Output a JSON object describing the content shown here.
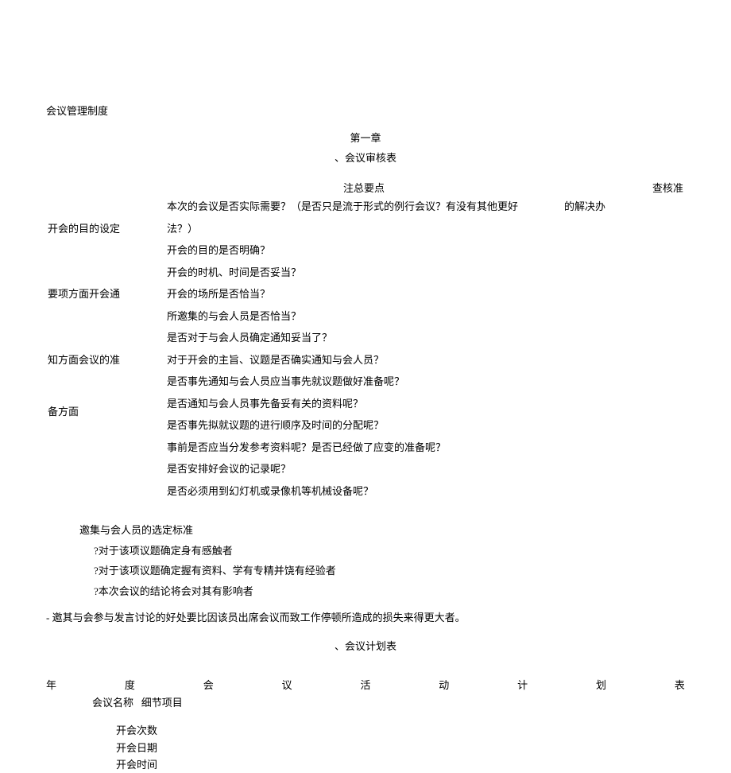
{
  "doc_title": "会议管理制度",
  "chapter_title": "第一章",
  "section1_title": "、会议审核表",
  "header": {
    "mid": "注总要点",
    "right": "查核准"
  },
  "groups": [
    {
      "left": "开会的目的设定",
      "lines": [
        {
          "text": "本次的会议是否实际需要？（是否只是流于形式的例行会议？有没有其他更好",
          "ext": "的解决办"
        },
        {
          "text": "法？）"
        },
        {
          "text": "开会的目的是否明确？"
        }
      ]
    },
    {
      "left": "要项方面开会通",
      "lines": [
        {
          "text": "开会的时机、时间是否妥当？"
        },
        {
          "text": "开会的场所是否恰当？"
        },
        {
          "text": "所邀集的与会人员是否恰当？"
        }
      ]
    },
    {
      "left": "知方面会议的准",
      "lines": [
        {
          "text": "是否对于与会人员确定通知妥当了？"
        },
        {
          "text": "对于开会的主旨、议题是否确实通知与会人员？"
        },
        {
          "text": "是否事先通知与会人员应当事先就议题做好准备呢？"
        }
      ]
    },
    {
      "left": "备方面",
      "lines": [
        {
          "text": "是否通知与会人员事先备妥有关的资料呢？"
        },
        {
          "text": "是否事先拟就议题的进行顺序及时间的分配呢？"
        },
        {
          "text": "事前是否应当分发参考资料呢？是否已经做了应变的准备呢？"
        },
        {
          "text": "是否安排好会议的记录呢？"
        },
        {
          "text": "是否必须用到幻灯机或录像机等机械设备呢？"
        }
      ]
    }
  ],
  "sub_title": "邀集与会人员的选定标准",
  "sub_items": [
    "?对于该项议题确定身有感触者",
    "?对于该项议题确定握有资料、学有专精并饶有经验者",
    "?本次会议的结论将会对其有影响者"
  ],
  "final_note": "- 邀其与会参与发言讨论的好处要比因该员出席会议而致工作停顿所造成的损失来得更大者。",
  "section2_title": "、会议计划表",
  "spread": [
    "年",
    "度",
    "会",
    "议",
    "活",
    "动",
    "计",
    "划",
    "表"
  ],
  "row_labels": {
    "a": "会议名称",
    "b": "细节项目"
  },
  "items2": [
    "开会次数",
    "开会日期",
    "开会时间"
  ]
}
